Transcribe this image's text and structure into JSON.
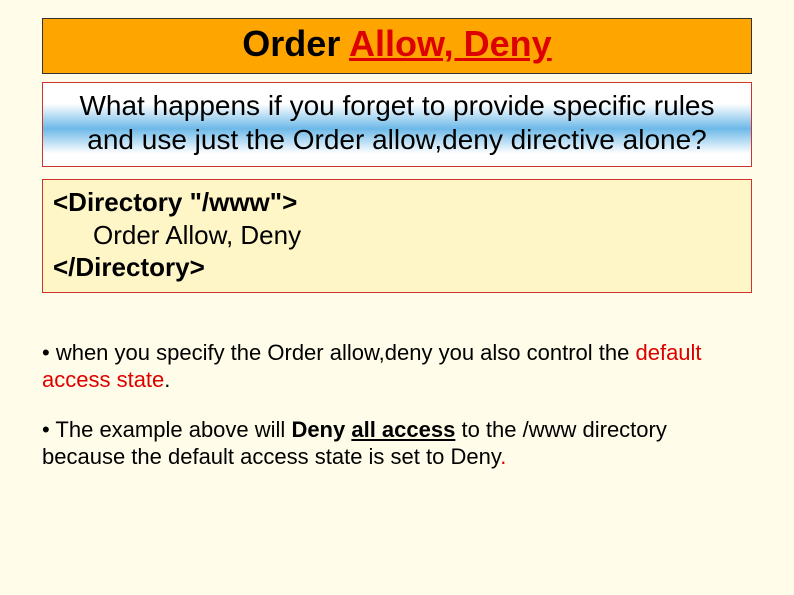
{
  "title": {
    "plain": "Order ",
    "highlight": "Allow, Deny"
  },
  "question": "What happens if you forget to provide specific rules and use just the Order allow,deny directive alone?",
  "code": {
    "open": "<Directory \"/www\">",
    "line": "Order Allow, Deny",
    "close": "</Directory>"
  },
  "bullets": {
    "b1_pre": "• when you specify the Order allow,deny you also control the ",
    "b1_red": "default access state",
    "b1_post": ".",
    "b2_pre": "• The example above will ",
    "b2_deny": "Deny",
    "b2_space1": " ",
    "b2_all_access": "all access",
    "b2_mid": " to the /www directory because the default access state is set to Deny",
    "b2_dot": "."
  }
}
